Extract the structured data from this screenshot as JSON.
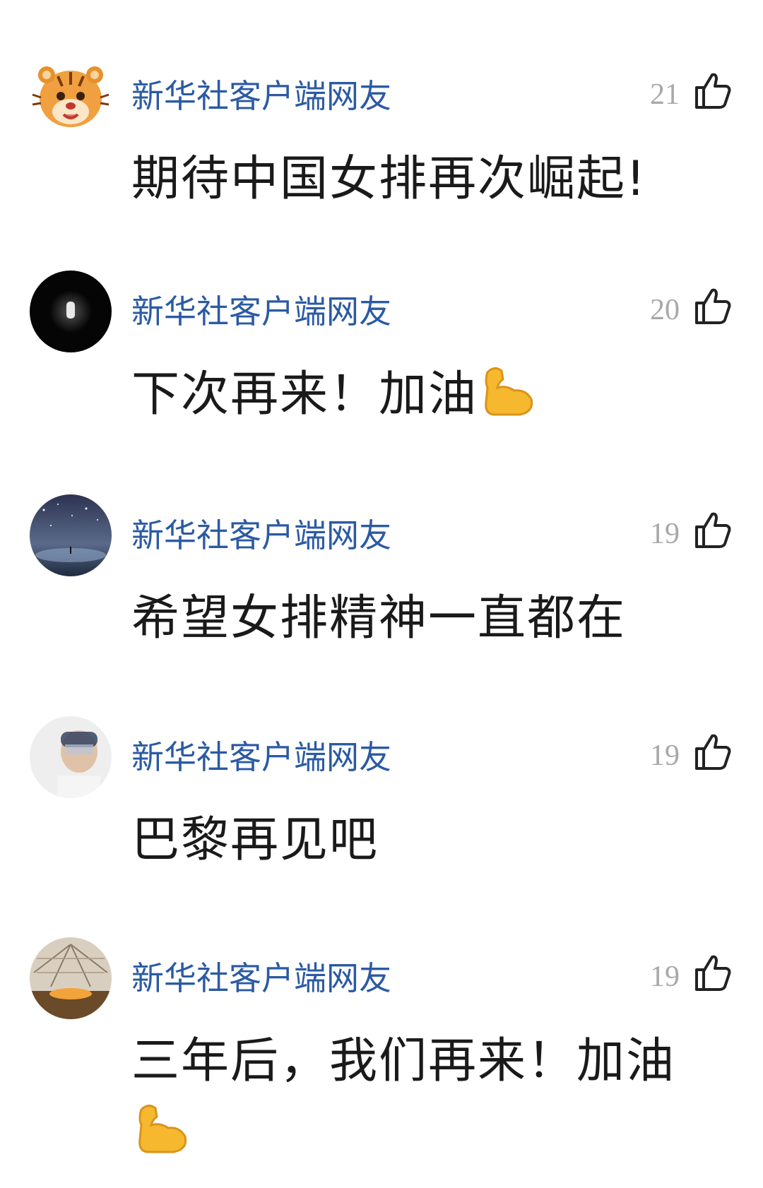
{
  "comments": [
    {
      "avatar": "tiger-cartoon-avatar",
      "username": "新华社客户端网友",
      "likes": "21",
      "text": "期待中国女排再次崛起!",
      "emoji": ""
    },
    {
      "avatar": "dark-window-avatar",
      "username": "新华社客户端网友",
      "likes": "20",
      "text": "下次再来！加油",
      "emoji": "flexed-biceps-emoji"
    },
    {
      "avatar": "starry-sky-avatar",
      "username": "新华社客户端网友",
      "likes": "19",
      "text": "希望女排精神一直都在",
      "emoji": ""
    },
    {
      "avatar": "person-photo-avatar",
      "username": "新华社客户端网友",
      "likes": "19",
      "text": "巴黎再见吧",
      "emoji": ""
    },
    {
      "avatar": "building-interior-avatar",
      "username": "新华社客户端网友",
      "likes": "19",
      "text": "三年后，我们再来！加油",
      "emoji": "flexed-biceps-emoji"
    }
  ],
  "colors": {
    "username": "#2b5aa3",
    "likes": "#a8a8a8",
    "text": "#1a1a1a",
    "background": "#ffffff"
  }
}
